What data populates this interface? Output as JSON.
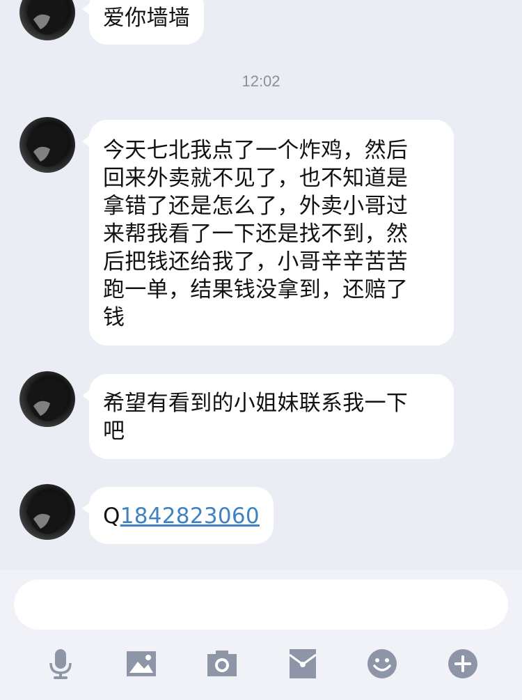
{
  "messages": [
    {
      "text": "爱你墙墙"
    },
    {
      "text": "今天七北我点了一个炸鸡，然后回来外卖就不见了，也不知道是拿错了还是怎么了，外卖小哥过来帮我看了一下还是找不到，然后把钱还给我了，小哥辛辛苦苦跑一单，结果钱没拿到，还赔了钱",
      "lines": [
        "今天七北我点了一个炸鸡，然后",
        "回来外卖就不见了，也不知道是",
        "拿错了还是怎么了，外卖小哥过",
        "来帮我看了一下还是找不到，然",
        "后把钱还给我了，小哥辛辛苦苦",
        "跑一单，结果钱没拿到，还赔了",
        "钱"
      ]
    },
    {
      "text": "希望有看到的小姐妹联系我一下吧",
      "lines": [
        "希望有看到的小姐妹联系我一下",
        "吧"
      ]
    },
    {
      "prefix": "Q",
      "link": "1842823060"
    }
  ],
  "timestamp": "12:02",
  "input": {
    "placeholder": ""
  },
  "toolbar": {
    "icons": [
      "microphone-icon",
      "image-icon",
      "camera-icon",
      "red-packet-icon",
      "emoji-icon",
      "plus-icon"
    ]
  },
  "colors": {
    "background": "#eaedf4",
    "bubble": "#ffffff",
    "link": "#3f82c4",
    "icon": "#8e95a6"
  }
}
